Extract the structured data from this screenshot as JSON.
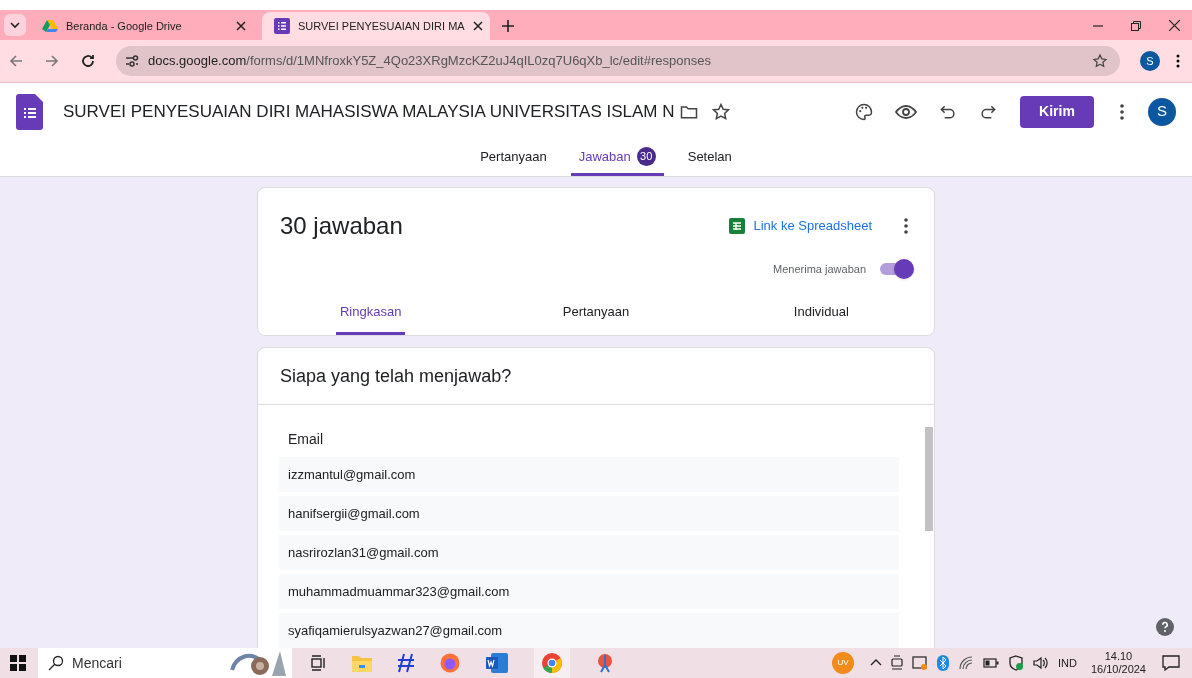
{
  "browser": {
    "tabs": [
      {
        "title": "Beranda - Google Drive",
        "kind": "drive",
        "selected": false
      },
      {
        "title": "SURVEI PENYESUAIAN DIRI MA",
        "kind": "forms",
        "selected": true
      }
    ],
    "address": {
      "domain": "docs.google.com",
      "path": "/forms/d/1MNfroxkY5Z_4Qo23XRgMzcKZ2uJ4qIL0zq7U6qXb_lc/edit#responses"
    },
    "profile": "S"
  },
  "form": {
    "title": "SURVEI PENYESUAIAN DIRI MAHASISWA MALAYSIA UNIVERSITAS ISLAM N",
    "send_button": "Kirim",
    "avatar": "S",
    "nav_tabs": [
      {
        "label": "Pertanyaan",
        "selected": false
      },
      {
        "label": "Jawaban",
        "badge": "30",
        "selected": true
      },
      {
        "label": "Setelan",
        "selected": false
      }
    ]
  },
  "responses": {
    "count_title": "30 jawaban",
    "spreadsheet_link": "Link ke Spreadsheet",
    "accepting": {
      "label": "Menerima jawaban",
      "on": true
    },
    "view_tabs": [
      {
        "label": "Ringkasan",
        "selected": true
      },
      {
        "label": "Pertanyaan",
        "selected": false
      },
      {
        "label": "Individual",
        "selected": false
      }
    ]
  },
  "who_answered": {
    "title": "Siapa yang telah menjawab?",
    "column_label": "Email",
    "emails": [
      "izzmantul@gmail.com",
      "hanifsergii@gmail.com",
      "nasrirozlan31@gmail.com",
      "muhammadmuammar323@gmail.com",
      "syafiqamierulsyazwan27@gmail.com"
    ]
  },
  "taskbar": {
    "search_placeholder": "Mencari",
    "tray_avatar": "UV",
    "language": "IND",
    "time": "14.10",
    "date": "16/10/2024"
  }
}
